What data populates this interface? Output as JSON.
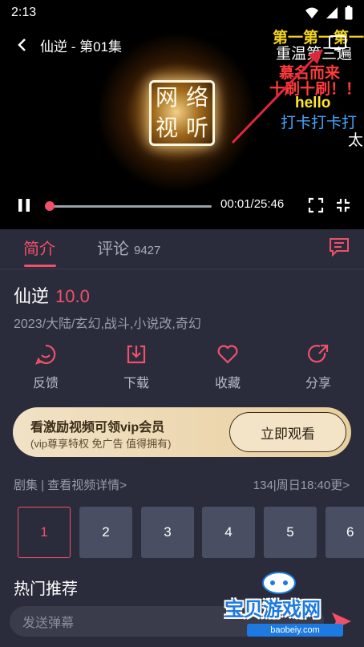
{
  "status_bar": {
    "time": "2:13"
  },
  "player": {
    "title": "仙逆 - 第01集",
    "logo_chars": [
      "网",
      "络",
      "视",
      "听"
    ],
    "time_readout": "00:01/25:46",
    "progress": 0.001,
    "danmu": [
      {
        "text": "第一第一第一",
        "color": "#f2d21c"
      },
      {
        "text": "重温第三遍",
        "color": "#ffffff"
      },
      {
        "text": "慕名而来",
        "color": "#ff3b3b"
      },
      {
        "text": "十刷十刷！！",
        "color": "#ff3b3b"
      },
      {
        "text": "hello",
        "color": "#ffe62e"
      },
      {
        "text": "打卡打卡打",
        "color": "#42a7ff"
      },
      {
        "text": "太",
        "color": "#ffffff"
      }
    ]
  },
  "tabs": {
    "intro": "简介",
    "comments": "评论",
    "comments_count": "9427"
  },
  "show": {
    "title": "仙逆",
    "score": "10.0",
    "meta": "2023/大陆/玄幻,战斗,小说改,奇幻"
  },
  "actions": [
    {
      "label": "反馈",
      "icon": "feedback-icon"
    },
    {
      "label": "下载",
      "icon": "download-icon"
    },
    {
      "label": "收藏",
      "icon": "heart-icon"
    },
    {
      "label": "分享",
      "icon": "share-icon"
    }
  ],
  "vip": {
    "title": "看激励视频可领vip会员",
    "subtitle": "(vip尊享特权 免广告 值得拥有)",
    "button": "立即观看"
  },
  "episodes": {
    "header": "剧集 | 查看视频详情>",
    "status": "134|周日18:40更>",
    "items": [
      "1",
      "2",
      "3",
      "4",
      "5",
      "6"
    ]
  },
  "hot": {
    "title": "热门推荐"
  },
  "danmu_input": {
    "placeholder": "发送弹幕"
  },
  "watermark": {
    "text": "宝贝游戏网",
    "url": "baobeiy.com"
  },
  "colors": {
    "accent": "#f0506a",
    "background": "#2a2c3b",
    "episode_bg": "#4a4e62",
    "vip_gold": "#e8cf9f"
  }
}
